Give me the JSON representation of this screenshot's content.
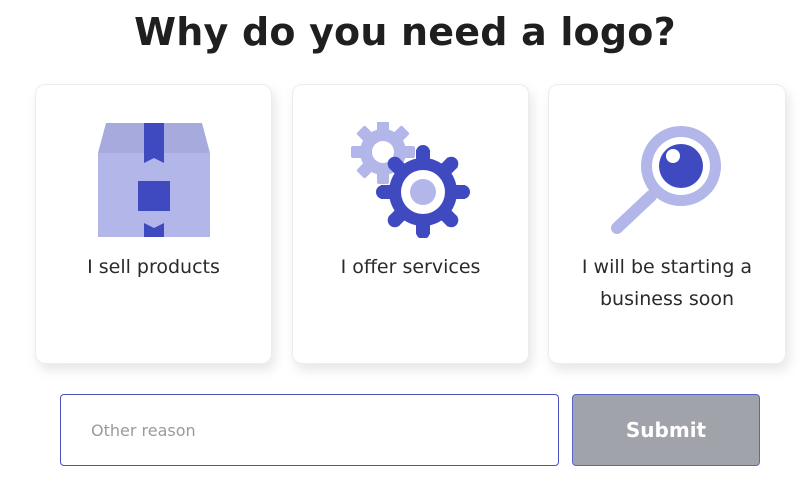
{
  "title": "Why do you need a logo?",
  "options": [
    {
      "label": "I sell products",
      "icon": "box-icon"
    },
    {
      "label": "I offer services",
      "icon": "gears-icon"
    },
    {
      "label": "I will be starting a business soon",
      "icon": "magnifier-icon"
    }
  ],
  "form": {
    "placeholder": "Other reason",
    "submit_label": "Submit"
  },
  "colors": {
    "accent": "#3f4ac0",
    "light_accent": "#b2b6e8",
    "button_gray": "#a0a4aa"
  }
}
